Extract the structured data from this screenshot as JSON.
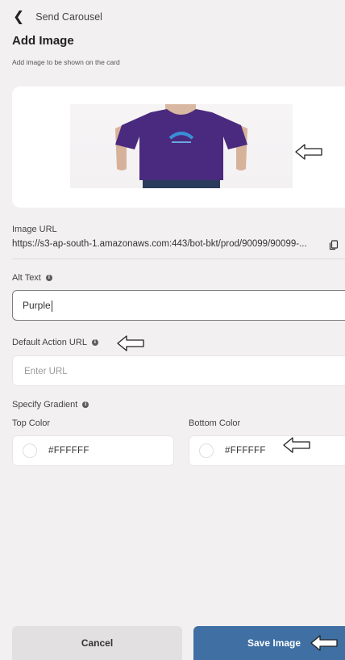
{
  "header": {
    "back_label": "Send Carousel",
    "title": "Add Image",
    "subtitle": "Add image to be shown on the card"
  },
  "image_url": {
    "label": "Image URL",
    "value": "https://s3-ap-south-1.amazonaws.com:443/bot-bkt/prod/90099/90099-..."
  },
  "alt_text": {
    "label": "Alt Text",
    "value": "Purple"
  },
  "default_action_url": {
    "label": "Default Action URL",
    "placeholder": "Enter URL"
  },
  "gradient": {
    "label": "Specify Gradient",
    "top": {
      "label": "Top Color",
      "value": "#FFFFFF"
    },
    "bottom": {
      "label": "Bottom Color",
      "value": "#FFFFFF"
    }
  },
  "footer": {
    "cancel_label": "Cancel",
    "save_label": "Save Image"
  },
  "colors": {
    "primary": "#3f6fa3",
    "background": "#f2f0f1",
    "shirt": "#4a2a7e"
  },
  "icons": [
    "chevron-left-icon",
    "info-icon",
    "copy-icon",
    "hint-arrow-icon",
    "color-swatch"
  ]
}
